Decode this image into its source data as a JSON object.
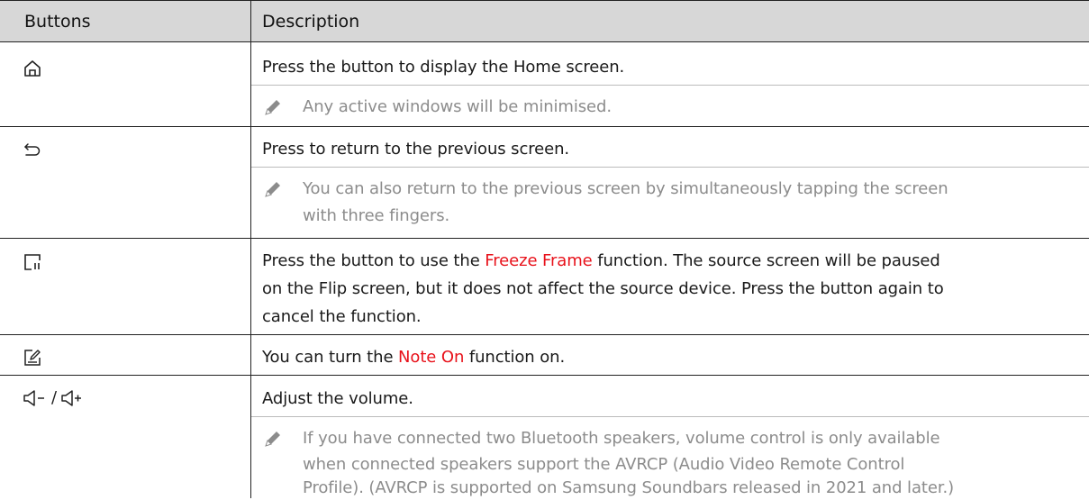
{
  "table": {
    "headers": [
      "Buttons",
      "Description"
    ],
    "rows": [
      {
        "icon": "home-icon",
        "text": "Press the button to display the Home screen.",
        "note": [
          "Any active windows will be minimised."
        ]
      },
      {
        "icon": "back-icon",
        "text": "Press to return to the previous screen.",
        "note": [
          "You can also return to the previous screen by simultaneously tapping the screen",
          "with three fingers."
        ]
      },
      {
        "icon": "freeze-frame-icon",
        "text_lines": [
          {
            "before": "Press the button to use the ",
            "highlight": "Freeze Frame",
            "after": " function. The source screen will be paused"
          },
          "on the Flip screen, but it does not affect the source device. Press the button again to",
          "cancel the function."
        ]
      },
      {
        "icon": "note-on-icon",
        "text_before": "You can turn the ",
        "highlight": "Note On",
        "text_after": " function on."
      },
      {
        "icon": "volume-icon",
        "icon_label": "/",
        "text": "Adjust the volume.",
        "note": [
          "If you have connected two Bluetooth speakers, volume control is only available",
          "when connected speakers support the AVRCP (Audio Video Remote Control",
          "Profile). (AVRCP is supported on Samsung Soundbars released in 2021 and later.)"
        ]
      }
    ]
  },
  "colors": {
    "header_bg": "#d7d7d7",
    "highlight": "#e8121b",
    "note_text": "#8c8c8c"
  }
}
